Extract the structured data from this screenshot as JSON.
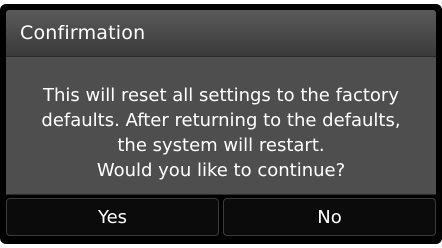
{
  "dialog": {
    "title": "Confirmation",
    "message_lines": [
      "This will reset all settings to the factory",
      "defaults. After returning to the defaults,",
      "the system will restart.",
      "Would you like to continue?"
    ],
    "buttons": {
      "yes_label": "Yes",
      "no_label": "No"
    }
  }
}
